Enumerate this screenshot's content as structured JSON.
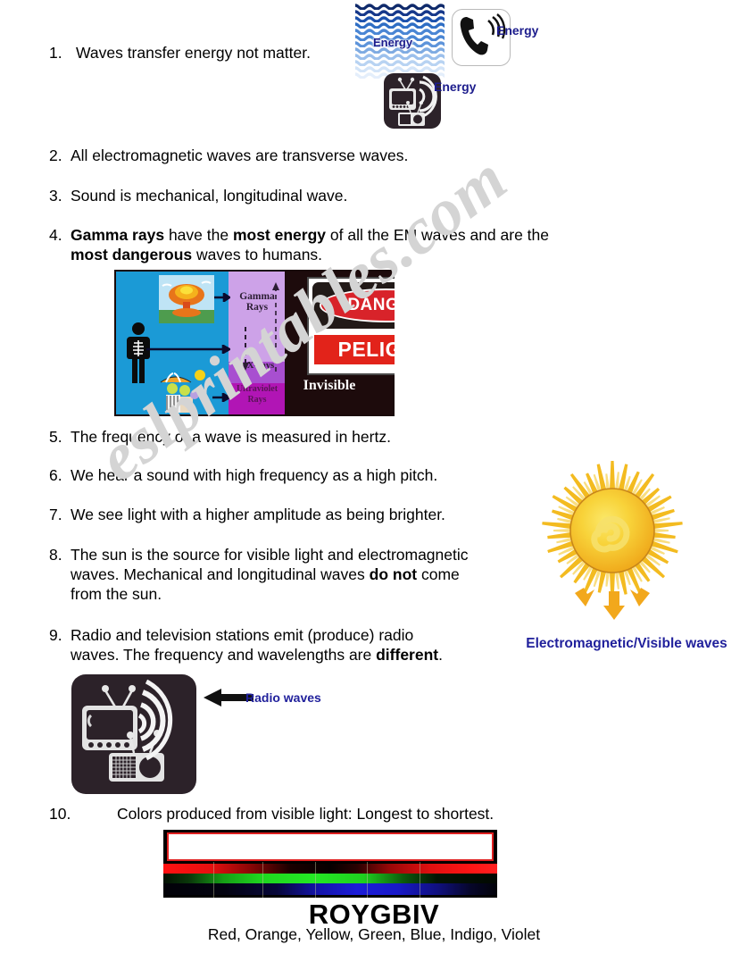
{
  "watermark": {
    "text": "eslprintables.com"
  },
  "colors": {
    "label_navy": "#21219c",
    "danger_red": "#e2231a",
    "sun_yellow": "#f5c021",
    "spectrum_border_red": "#e02020",
    "blue_panel": "#1b9ad6",
    "purple_panel": "#cda2e8"
  },
  "list": [
    {
      "num": "1.",
      "text": "Waves transfer energy not matter."
    },
    {
      "num": "2.",
      "text": "All electromagnetic waves are transverse waves."
    },
    {
      "num": "3.",
      "text": "Sound is mechanical, longitudinal wave."
    },
    {
      "num": "4.",
      "line1_bold1": "Gamma rays",
      "line1_plain1": "  have the ",
      "line1_bold2": "most energy",
      "line1_plain2": " of all the EM waves and are the",
      "line2_bold1": "most dangerous",
      "line2_plain1": " waves to humans."
    },
    {
      "num": "5.",
      "text": "The frequency of a wave is measured in hertz."
    },
    {
      "num": "6.",
      "text": "We hear a sound with high frequency as a high pitch."
    },
    {
      "num": "7.",
      "text": "We see light with a higher amplitude as being brighter."
    },
    {
      "num": "8.",
      "line1": "The sun is the source for visible light and electromagnetic",
      "line2_plain1": "waves.   Mechanical and longitudinal waves ",
      "line2_bold1": "do not",
      "line2_plain2": " come",
      "line3": "from the sun."
    },
    {
      "num": "9.",
      "line1": "Radio and television stations emit (produce) radio",
      "line2_plain1": "waves.   The frequency and wavelengths are ",
      "line2_bold1": "different",
      "line2_plain2": "."
    },
    {
      "num": "10.",
      "text": "Colors produced from visible light: Longest to shortest."
    }
  ],
  "top_cluster": {
    "waves_label": "Energy",
    "phone_label": "Energy",
    "tv_label": "Energy"
  },
  "em_figure": {
    "gamma_label": "Gamma Rays",
    "xray_label": "X-rays",
    "uv_label": "Ultraviolet Rays",
    "invisible_label": "Invisible",
    "danger_label": "DANGER",
    "peligro_label": "PELIGRO"
  },
  "sun": {
    "caption": "Electromagnetic/Visible waves"
  },
  "radio": {
    "label": "Radio waves"
  },
  "spectrum": {
    "acronym": "ROYGBIV",
    "color_names": "Red, Orange, Yellow, Green, Blue, Indigo, Violet"
  }
}
